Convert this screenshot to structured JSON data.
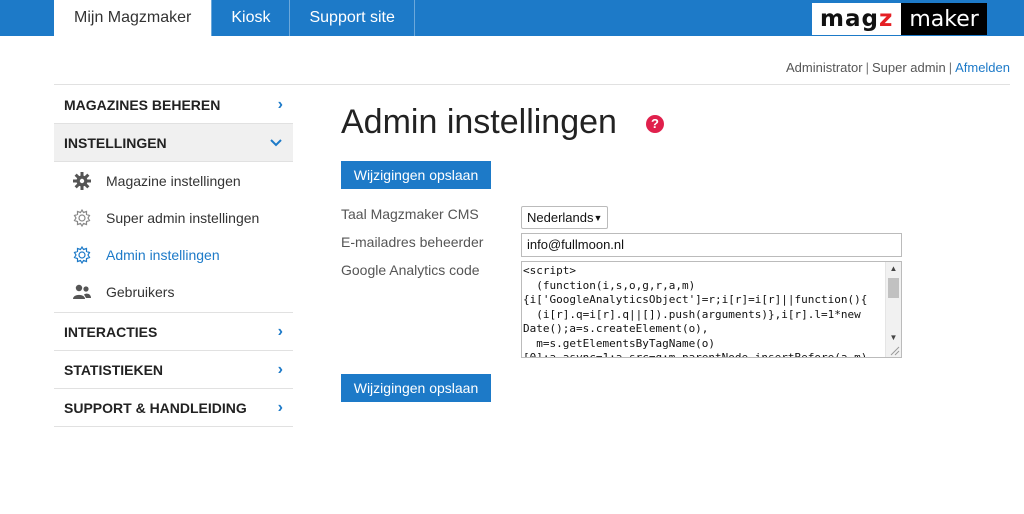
{
  "tabs": [
    {
      "label": "Mijn Magzmaker",
      "active": true
    },
    {
      "label": "Kiosk",
      "active": false
    },
    {
      "label": "Support site",
      "active": false
    }
  ],
  "logo": {
    "part1": "mag",
    "part1_accent": "z",
    "part2": "maker"
  },
  "userbar": {
    "user": "Administrator",
    "role": "Super admin",
    "logout": "Afmelden"
  },
  "sidebar": {
    "sections": [
      {
        "label": "MAGAZINES BEHEREN",
        "chevron": "›"
      },
      {
        "label": "INSTELLINGEN",
        "chevron": "⌄"
      },
      {
        "label": "INTERACTIES",
        "chevron": "›"
      },
      {
        "label": "STATISTIEKEN",
        "chevron": "›"
      },
      {
        "label": "SUPPORT & HANDLEIDING",
        "chevron": "›"
      }
    ],
    "subitems": [
      {
        "label": "Magazine instellingen",
        "icon": "gear-icon"
      },
      {
        "label": "Super admin instellingen",
        "icon": "gear-outline-icon"
      },
      {
        "label": "Admin instellingen",
        "icon": "gear-outline-icon",
        "active": true
      },
      {
        "label": "Gebruikers",
        "icon": "users-icon"
      }
    ]
  },
  "main": {
    "title": "Admin instellingen",
    "help": "?",
    "save_label": "Wijzigingen opslaan",
    "fields": {
      "language_label": "Taal Magzmaker CMS",
      "language_value": "Nederlands",
      "email_label": "E-mailadres beheerder",
      "email_value": "info@fullmoon.nl",
      "ga_label": "Google Analytics code",
      "ga_value": "<script>\n  (function(i,s,o,g,r,a,m)\n{i['GoogleAnalyticsObject']=r;i[r]=i[r]||function(){\n  (i[r].q=i[r].q||[]).push(arguments)},i[r].l=1*new\nDate();a=s.createElement(o),\n  m=s.getElementsByTagName(o)\n[0];a.async=1;a.src=g;m.parentNode.insertBefore(a,m)"
    }
  },
  "colors": {
    "accent": "#1d7ac8",
    "help": "#e0204c",
    "logo_z": "#e52025"
  }
}
